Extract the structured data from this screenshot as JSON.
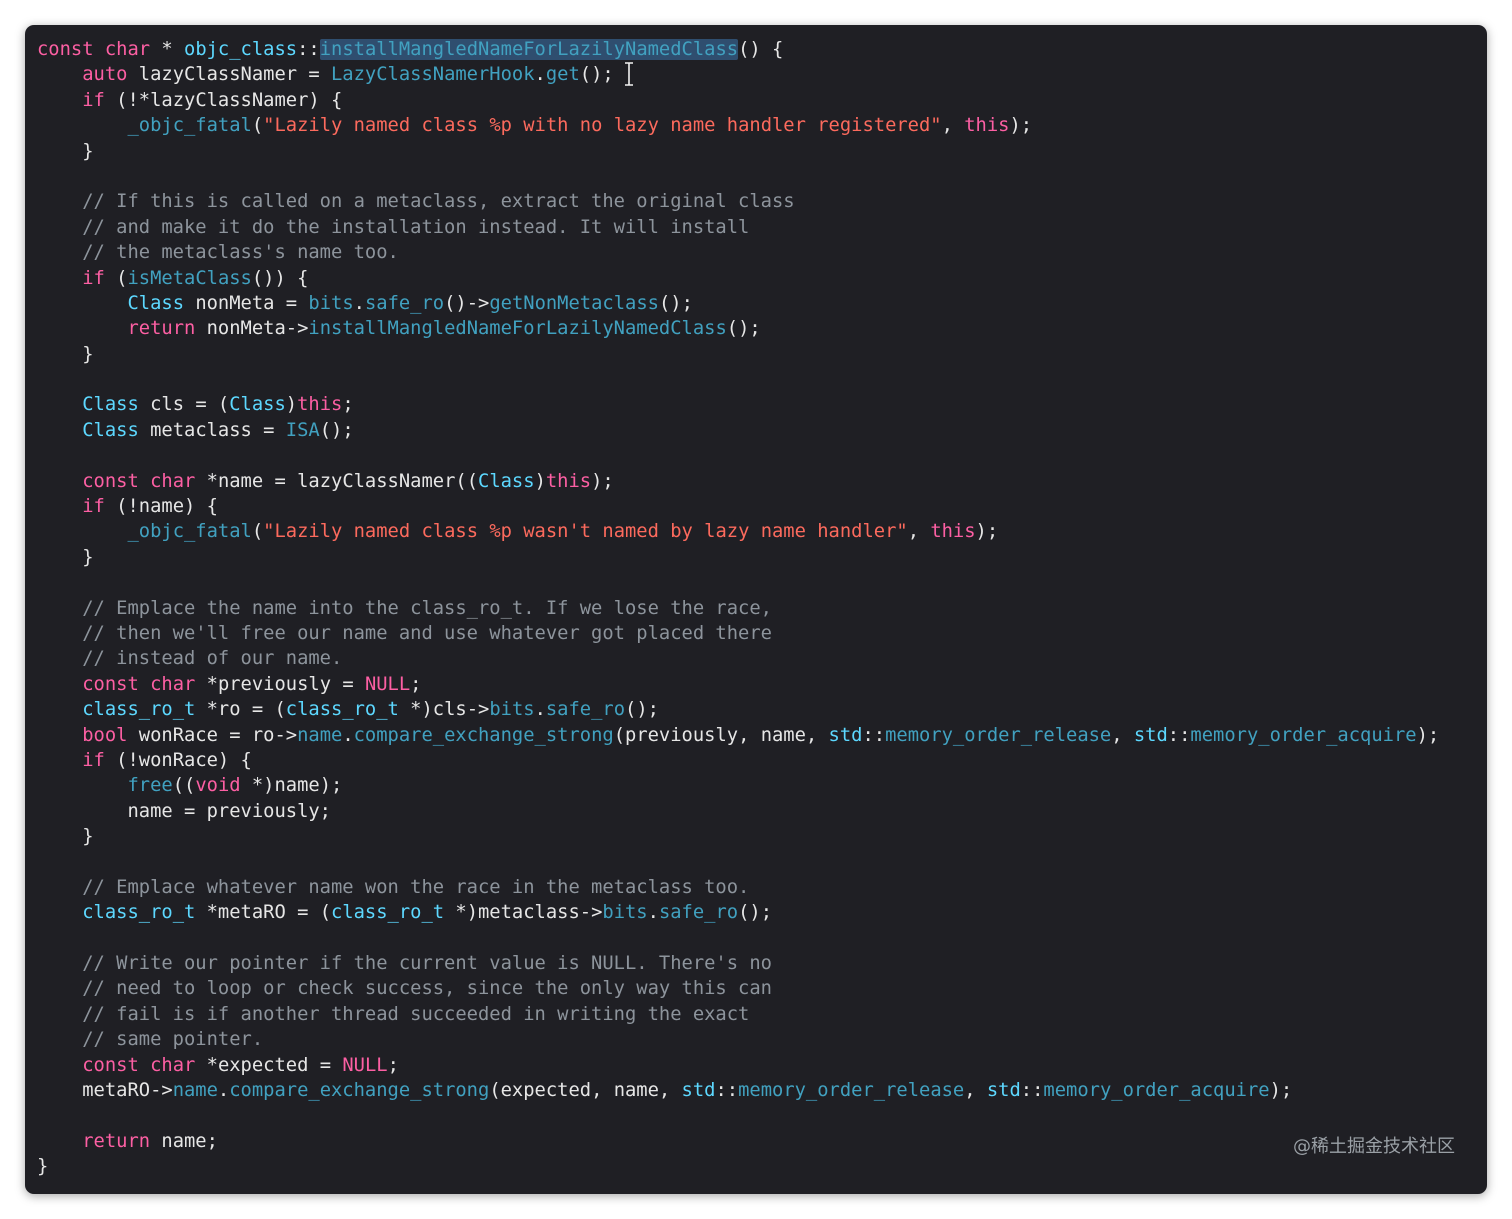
{
  "code": {
    "lines": [
      [
        {
          "t": "const",
          "c": "kw"
        },
        {
          "t": " "
        },
        {
          "t": "char",
          "c": "kw"
        },
        {
          "t": " * "
        },
        {
          "t": "objc_class",
          "c": "ty"
        },
        {
          "t": "::"
        },
        {
          "t": "installMangledNameForLazilyNamedClass",
          "c": "fn hl"
        },
        {
          "t": "() {"
        }
      ],
      [
        {
          "t": "    "
        },
        {
          "t": "auto",
          "c": "kw"
        },
        {
          "t": " lazyClassNamer = "
        },
        {
          "t": "LazyClassNamerHook",
          "c": "fn"
        },
        {
          "t": "."
        },
        {
          "t": "get",
          "c": "fn"
        },
        {
          "t": "();"
        }
      ],
      [
        {
          "t": "    "
        },
        {
          "t": "if",
          "c": "kw"
        },
        {
          "t": " (!*lazyClassNamer) {"
        }
      ],
      [
        {
          "t": "        "
        },
        {
          "t": "_objc_fatal",
          "c": "fn"
        },
        {
          "t": "("
        },
        {
          "t": "\"Lazily named class %p with no lazy name handler registered\"",
          "c": "st"
        },
        {
          "t": ", "
        },
        {
          "t": "this",
          "c": "kw"
        },
        {
          "t": ");"
        }
      ],
      [
        {
          "t": "    }"
        }
      ],
      [],
      [
        {
          "t": "    // If this is called on a metaclass, extract the original class",
          "c": "cm"
        }
      ],
      [
        {
          "t": "    // and make it do the installation instead. It will install",
          "c": "cm"
        }
      ],
      [
        {
          "t": "    // the metaclass's name too.",
          "c": "cm"
        }
      ],
      [
        {
          "t": "    "
        },
        {
          "t": "if",
          "c": "kw"
        },
        {
          "t": " ("
        },
        {
          "t": "isMetaClass",
          "c": "fn"
        },
        {
          "t": "()) {"
        }
      ],
      [
        {
          "t": "        "
        },
        {
          "t": "Class",
          "c": "ty"
        },
        {
          "t": " nonMeta = "
        },
        {
          "t": "bits",
          "c": "fn"
        },
        {
          "t": "."
        },
        {
          "t": "safe_ro",
          "c": "fn"
        },
        {
          "t": "()->"
        },
        {
          "t": "getNonMetaclass",
          "c": "fn"
        },
        {
          "t": "();"
        }
      ],
      [
        {
          "t": "        "
        },
        {
          "t": "return",
          "c": "kw"
        },
        {
          "t": " nonMeta->"
        },
        {
          "t": "installMangledNameForLazilyNamedClass",
          "c": "fn"
        },
        {
          "t": "();"
        }
      ],
      [
        {
          "t": "    }"
        }
      ],
      [],
      [
        {
          "t": "    "
        },
        {
          "t": "Class",
          "c": "ty"
        },
        {
          "t": " cls = ("
        },
        {
          "t": "Class",
          "c": "ty"
        },
        {
          "t": ")"
        },
        {
          "t": "this",
          "c": "kw"
        },
        {
          "t": ";"
        }
      ],
      [
        {
          "t": "    "
        },
        {
          "t": "Class",
          "c": "ty"
        },
        {
          "t": " metaclass = "
        },
        {
          "t": "ISA",
          "c": "fn"
        },
        {
          "t": "();"
        }
      ],
      [],
      [
        {
          "t": "    "
        },
        {
          "t": "const",
          "c": "kw"
        },
        {
          "t": " "
        },
        {
          "t": "char",
          "c": "kw"
        },
        {
          "t": " *name = lazyClassNamer(("
        },
        {
          "t": "Class",
          "c": "ty"
        },
        {
          "t": ")"
        },
        {
          "t": "this",
          "c": "kw"
        },
        {
          "t": ");"
        }
      ],
      [
        {
          "t": "    "
        },
        {
          "t": "if",
          "c": "kw"
        },
        {
          "t": " (!name) {"
        }
      ],
      [
        {
          "t": "        "
        },
        {
          "t": "_objc_fatal",
          "c": "fn"
        },
        {
          "t": "("
        },
        {
          "t": "\"Lazily named class %p wasn't named by lazy name handler\"",
          "c": "st"
        },
        {
          "t": ", "
        },
        {
          "t": "this",
          "c": "kw"
        },
        {
          "t": ");"
        }
      ],
      [
        {
          "t": "    }"
        }
      ],
      [],
      [
        {
          "t": "    // Emplace the name into the class_ro_t. If we lose the race,",
          "c": "cm"
        }
      ],
      [
        {
          "t": "    // then we'll free our name and use whatever got placed there",
          "c": "cm"
        }
      ],
      [
        {
          "t": "    // instead of our name.",
          "c": "cm"
        }
      ],
      [
        {
          "t": "    "
        },
        {
          "t": "const",
          "c": "kw"
        },
        {
          "t": " "
        },
        {
          "t": "char",
          "c": "kw"
        },
        {
          "t": " *previously = "
        },
        {
          "t": "NULL",
          "c": "kw"
        },
        {
          "t": ";"
        }
      ],
      [
        {
          "t": "    "
        },
        {
          "t": "class_ro_t",
          "c": "ty"
        },
        {
          "t": " *ro = ("
        },
        {
          "t": "class_ro_t",
          "c": "ty"
        },
        {
          "t": " *)cls->"
        },
        {
          "t": "bits",
          "c": "fn"
        },
        {
          "t": "."
        },
        {
          "t": "safe_ro",
          "c": "fn"
        },
        {
          "t": "();"
        }
      ],
      [
        {
          "t": "    "
        },
        {
          "t": "bool",
          "c": "kw"
        },
        {
          "t": " wonRace = ro->"
        },
        {
          "t": "name",
          "c": "fn"
        },
        {
          "t": "."
        },
        {
          "t": "compare_exchange_strong",
          "c": "fn"
        },
        {
          "t": "(previously, name, "
        },
        {
          "t": "std",
          "c": "ty"
        },
        {
          "t": "::"
        },
        {
          "t": "memory_order_release",
          "c": "fn"
        },
        {
          "t": ", "
        },
        {
          "t": "std",
          "c": "ty"
        },
        {
          "t": "::"
        },
        {
          "t": "memory_order_acquire",
          "c": "fn"
        },
        {
          "t": ");"
        }
      ],
      [
        {
          "t": "    "
        },
        {
          "t": "if",
          "c": "kw"
        },
        {
          "t": " (!wonRace) {"
        }
      ],
      [
        {
          "t": "        "
        },
        {
          "t": "free",
          "c": "fn"
        },
        {
          "t": "(("
        },
        {
          "t": "void",
          "c": "kw"
        },
        {
          "t": " *)name);"
        }
      ],
      [
        {
          "t": "        name = previously;"
        }
      ],
      [
        {
          "t": "    }"
        }
      ],
      [],
      [
        {
          "t": "    // Emplace whatever name won the race in the metaclass too.",
          "c": "cm"
        }
      ],
      [
        {
          "t": "    "
        },
        {
          "t": "class_ro_t",
          "c": "ty"
        },
        {
          "t": " *metaRO = ("
        },
        {
          "t": "class_ro_t",
          "c": "ty"
        },
        {
          "t": " *)metaclass->"
        },
        {
          "t": "bits",
          "c": "fn"
        },
        {
          "t": "."
        },
        {
          "t": "safe_ro",
          "c": "fn"
        },
        {
          "t": "();"
        }
      ],
      [],
      [
        {
          "t": "    // Write our pointer if the current value is NULL. There's no",
          "c": "cm"
        }
      ],
      [
        {
          "t": "    // need to loop or check success, since the only way this can",
          "c": "cm"
        }
      ],
      [
        {
          "t": "    // fail is if another thread succeeded in writing the exact",
          "c": "cm"
        }
      ],
      [
        {
          "t": "    // same pointer.",
          "c": "cm"
        }
      ],
      [
        {
          "t": "    "
        },
        {
          "t": "const",
          "c": "kw"
        },
        {
          "t": " "
        },
        {
          "t": "char",
          "c": "kw"
        },
        {
          "t": " *expected = "
        },
        {
          "t": "NULL",
          "c": "kw"
        },
        {
          "t": ";"
        }
      ],
      [
        {
          "t": "    metaRO->"
        },
        {
          "t": "name",
          "c": "fn"
        },
        {
          "t": "."
        },
        {
          "t": "compare_exchange_strong",
          "c": "fn"
        },
        {
          "t": "(expected, name, "
        },
        {
          "t": "std",
          "c": "ty"
        },
        {
          "t": "::"
        },
        {
          "t": "memory_order_release",
          "c": "fn"
        },
        {
          "t": ", "
        },
        {
          "t": "std",
          "c": "ty"
        },
        {
          "t": "::"
        },
        {
          "t": "memory_order_acquire",
          "c": "fn"
        },
        {
          "t": ");"
        }
      ],
      [],
      [
        {
          "t": "    "
        },
        {
          "t": "return",
          "c": "kw"
        },
        {
          "t": " name;"
        }
      ],
      [
        {
          "t": "}"
        }
      ]
    ]
  },
  "cursor_icon": "text-cursor-icon",
  "watermark": "@稀土掘金技术社区",
  "colors": {
    "background": "#1f1f24",
    "keyword": "#fc5fa3",
    "function": "#41a1c0",
    "type": "#5dd8ff",
    "string": "#fc6a5d",
    "comment": "#8d949c",
    "plain": "#e6e6e6",
    "selection": "#2f4e6f"
  }
}
